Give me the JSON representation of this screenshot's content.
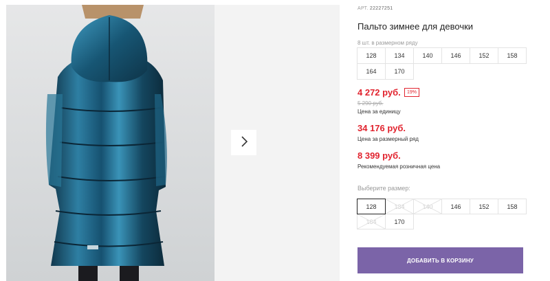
{
  "gallery": {
    "next_icon": "chevron-right-icon"
  },
  "product": {
    "article_label": "АРТ.",
    "article_value": "22227251",
    "title": "Пальто зимнее для девочки",
    "pack_label": "8 шт. в размерном ряду",
    "pack_sizes": [
      "128",
      "134",
      "140",
      "146",
      "152",
      "158",
      "164",
      "170"
    ]
  },
  "prices": {
    "unit_price": "4 272 руб.",
    "discount": "19%",
    "old_price": "5 290 руб.",
    "unit_caption": "Цена за единицу",
    "row_price": "34 176 руб.",
    "row_caption": "Цена за размерный ряд",
    "retail_price": "8 399 руб.",
    "retail_caption": "Рекомендуемая розничная цена"
  },
  "size_select": {
    "label": "Выберите размер:",
    "options": [
      {
        "label": "128",
        "state": "selected"
      },
      {
        "label": "134",
        "state": "disabled"
      },
      {
        "label": "140",
        "state": "disabled"
      },
      {
        "label": "146",
        "state": "available"
      },
      {
        "label": "152",
        "state": "available"
      },
      {
        "label": "158",
        "state": "available"
      },
      {
        "label": "164",
        "state": "disabled"
      },
      {
        "label": "170",
        "state": "available"
      }
    ]
  },
  "cart": {
    "add_label": "ДОБАВИТЬ В КОРЗИНУ"
  },
  "colors": {
    "accent": "#7b64a8",
    "price_red": "#e1232e",
    "jacket": "#1d5a78"
  }
}
